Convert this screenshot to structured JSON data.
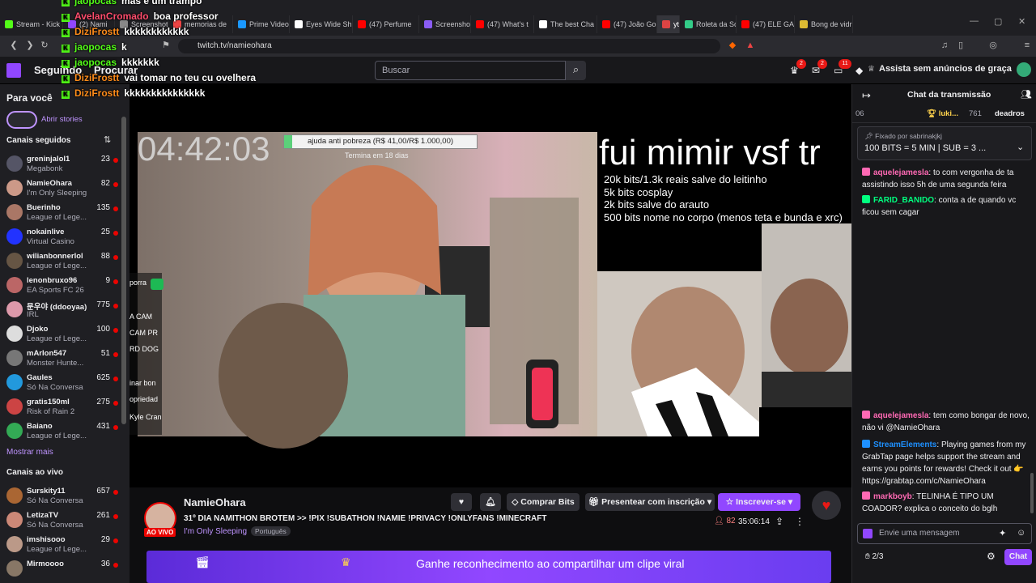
{
  "browser": {
    "tabs": [
      {
        "label": "Stream - Kick",
        "color": "#53fc18"
      },
      {
        "label": "(2) Nami",
        "color": "#9147ff"
      },
      {
        "label": "Screenshot p",
        "color": "#888"
      },
      {
        "label": "memorias de",
        "color": "#e44"
      },
      {
        "label": "Prime Video:",
        "color": "#1a98ff"
      },
      {
        "label": "Eyes Wide Sh",
        "color": "#fff"
      },
      {
        "label": "(47) Perfume",
        "color": "#f00"
      },
      {
        "label": "Screenshot p",
        "color": "#8a5cf5"
      },
      {
        "label": "(47) What's t",
        "color": "#f00"
      },
      {
        "label": "The best Cha",
        "color": "#fff"
      },
      {
        "label": "(47) João Go",
        "color": "#f00"
      },
      {
        "label": "ytb",
        "color": "#d44"
      },
      {
        "label": "Roleta da So",
        "color": "#3c8"
      },
      {
        "label": "(47) ELE GAN",
        "color": "#f00"
      },
      {
        "label": "Bong de vidr",
        "color": "#db3"
      }
    ],
    "url": "twitch.tv/namieohara"
  },
  "overlay_chat": [
    {
      "user": "jaopocas",
      "text": "mas é um trampo",
      "color": "#53fc18"
    },
    {
      "user": "AvelanCromado",
      "text": "boa professor",
      "color": "#ff4d6d"
    },
    {
      "user": "DiziFrostt",
      "text": "kkkkkkkkkkkk",
      "color": "#ff8c1a"
    },
    {
      "user": "jaopocas",
      "text": "k",
      "color": "#53fc18"
    },
    {
      "user": "jaopocas",
      "text": "kkkkkkk",
      "color": "#53fc18"
    },
    {
      "user": "DiziFrostt",
      "text": "vai tomar no teu cu ovelhera",
      "color": "#ff8c1a"
    },
    {
      "user": "DiziFrostt",
      "text": "kkkkkkkkkkkkkkk",
      "color": "#ff8c1a"
    }
  ],
  "topnav": {
    "following": "Seguindo",
    "browse": "Procurar",
    "search_placeholder": "Buscar",
    "badges": [
      "2",
      "2",
      "11"
    ],
    "ad_free": "Assista sem anúncios de graça"
  },
  "sidebar": {
    "for_you": "Para você",
    "stories": "Abrir stories",
    "followed_header": "Canais seguidos",
    "followed": [
      {
        "name": "greninjalol1",
        "game": "Megabonk",
        "count": "23",
        "color": "#556"
      },
      {
        "name": "NamieOhara",
        "game": "I'm Only Sleeping",
        "count": "82",
        "color": "#c98"
      },
      {
        "name": "Buerinho",
        "game": "League of Lege...",
        "count": "135",
        "color": "#a76"
      },
      {
        "name": "nokainlive",
        "game": "Virtual Casino",
        "count": "25",
        "color": "#23f"
      },
      {
        "name": "wilianbonnerlol",
        "game": "League of Lege...",
        "count": "88",
        "color": "#654"
      },
      {
        "name": "lenonbruxo96",
        "game": "EA Sports FC 26",
        "count": "9",
        "color": "#b66"
      },
      {
        "name": "문우야 (ddooyaa)",
        "game": "IRL",
        "count": "775",
        "color": "#d9a"
      },
      {
        "name": "Djoko",
        "game": "League of Lege...",
        "count": "100",
        "color": "#ddd"
      },
      {
        "name": "mArIon547",
        "game": "Monster Hunte...",
        "count": "51",
        "color": "#777"
      },
      {
        "name": "Gaules",
        "game": "Só Na Conversa",
        "count": "625",
        "color": "#29d"
      },
      {
        "name": "gratis150ml",
        "game": "Risk of Rain 2",
        "count": "275",
        "color": "#c44"
      },
      {
        "name": "Baiano",
        "game": "League of Lege...",
        "count": "431",
        "color": "#3a5"
      }
    ],
    "show_more": "Mostrar mais",
    "live_header": "Canais ao vivo",
    "live": [
      {
        "name": "Surskity11",
        "game": "Só Na Conversa",
        "count": "657",
        "color": "#a63"
      },
      {
        "name": "LetizaTV",
        "game": "Só Na Conversa",
        "count": "261",
        "color": "#c87"
      },
      {
        "name": "imshisooo",
        "game": "League of Lege...",
        "count": "29",
        "color": "#b98"
      },
      {
        "name": "Mirmoooo",
        "game": "",
        "count": "36",
        "color": "#876"
      }
    ]
  },
  "stream": {
    "timer": "04:42:03",
    "goal_text": "ajuda anti pobreza (R$ 41,00/R$ 1.000,00)",
    "goal_sub": "Termina em 18 dias",
    "big_text": "fui mimir vsf tr",
    "bits_lines": [
      "20k bits/1.3k reais salve do leitinho",
      "5k bits cosplay",
      "2k bits salve do arauto",
      "500 bits nome no corpo (menos teta e bunda e xrc)"
    ],
    "left_fragments": [
      "porra",
      "A CAM",
      "CAM PR",
      "RD DOG",
      "inar bon",
      "opriedad",
      "Kyle Cran"
    ],
    "progress": 0.041
  },
  "channel": {
    "name": "NamieOhara",
    "title": "31º DIA NAMITHON BROTEM >> !PIX !SUBATHON !NAMIE !PRIVACY !ONLYFANS !MINECRAFT",
    "category": "I'm Only Sleeping",
    "tag": "Português",
    "live_label": "AO VIVO",
    "viewers": "82",
    "uptime": "35:06:14",
    "buy_bits": "Comprar Bits",
    "gift_sub": "Presentear com inscrição",
    "subscribe": "Inscrever-se",
    "banner": "Ganhe reconhecimento ao compartilhar um clipe viral"
  },
  "chat": {
    "header": "Chat da transmissão",
    "leaderboard": [
      {
        "rank": "06",
        "name": "",
        "count": ""
      },
      {
        "rank": "",
        "name": "luki...",
        "count": "761"
      },
      {
        "rank": "",
        "name": "deadros",
        "count": ""
      }
    ],
    "pinned_by": "Fixado por",
    "pinned_user": "sabrinakjkj",
    "pinned_text": "100 BITS = 5 MIN | SUB = 3 ...",
    "messages_top": [
      {
        "user": "aquelejamesla",
        "color": "#ff69b4",
        "text": "to com vergonha de ta assistindo isso 5h de uma segunda feira"
      },
      {
        "user": "FARID_BANIDO",
        "color": "#00ff7f",
        "text": "conta a de quando vc ficou sem cagar"
      }
    ],
    "messages_bottom": [
      {
        "user": "aquelejamesla",
        "color": "#ff69b4",
        "text": "tem como bongar de novo, não vi @NamieOhara"
      },
      {
        "user": "StreamElements",
        "color": "#1e90ff",
        "text": "Playing games from my GrabTap page helps support the stream and earns you points for rewards! Check it out 👉 https://grabtap.com/c/NamieOhara"
      },
      {
        "user": "markboyb",
        "color": "#ff69b4",
        "text": "TELINHA É TIPO UM COADOR? explica o conceito do bglh"
      }
    ],
    "input_placeholder": "Envie uma mensagem",
    "points": "2/3",
    "send": "Chat"
  }
}
